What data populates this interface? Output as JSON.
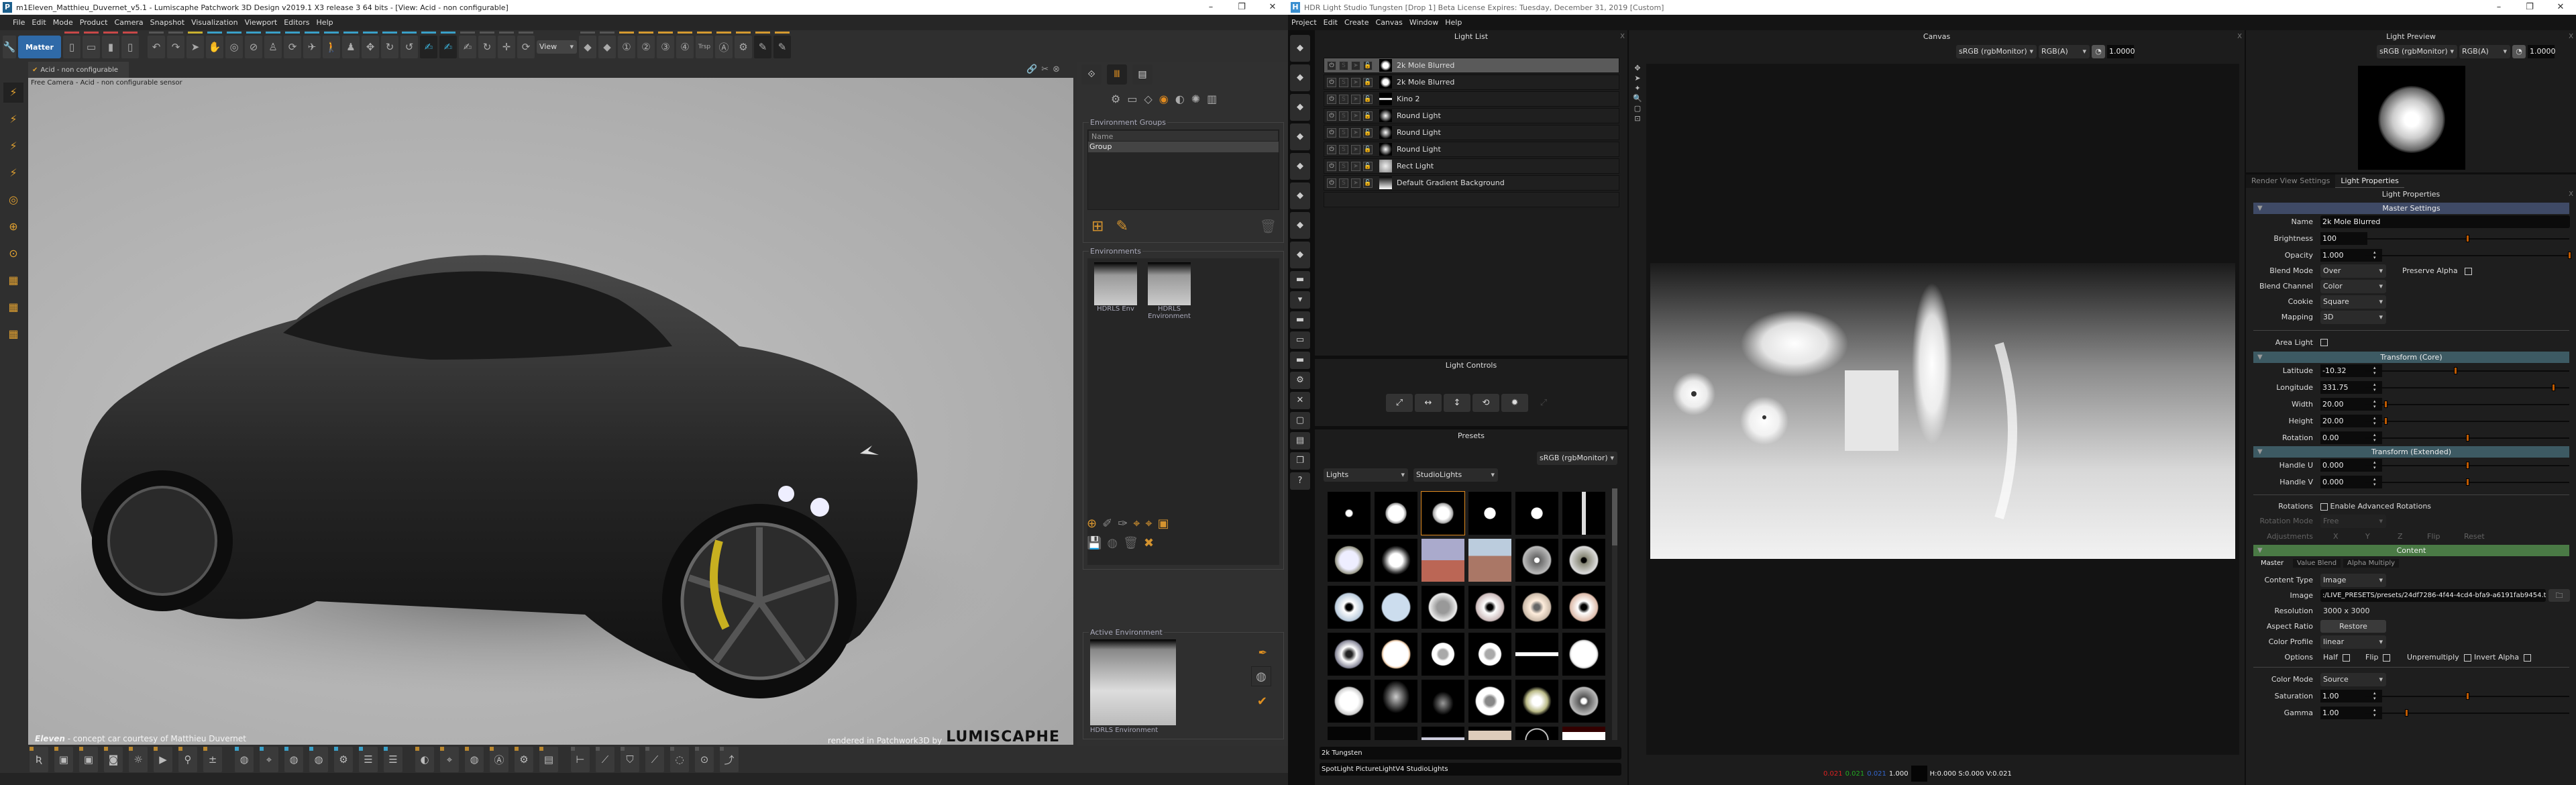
{
  "patchwork": {
    "title": "m1Eleven_Matthieu_Duvernet_v5.1 - Lumiscaphe Patchwork 3D Design v2019.1 X3 release 3  64 bits - [View: Acid - non configurable]",
    "menu": [
      "File",
      "Edit",
      "Mode",
      "Product",
      "Camera",
      "Snapshot",
      "Visualization",
      "Viewport",
      "Editors",
      "Help"
    ],
    "matter_label": "Matter",
    "view_label": "View",
    "trsp_label": "Trsp",
    "toolbar_icons": [
      "new-file",
      "open-file",
      "save",
      "save-as",
      "undo",
      "redo",
      "select",
      "hand",
      "orbit",
      "zoom",
      "light-bulb",
      "rotate-view",
      "fly",
      "walk",
      "person",
      "move-axis",
      "rotate-object",
      "rotate-arbitrary",
      "paint-cyan",
      "paint-cyan-2",
      "paint-gray",
      "paint-refresh",
      "pan-cross",
      "refresh"
    ],
    "toolbar_icons_right": [
      "camera-prev",
      "camera-next",
      "camera-1",
      "camera-2",
      "camera-3",
      "camera-4",
      "transparency",
      "snapshot-a",
      "settings-gear",
      "pencil-active",
      "pencil-disabled"
    ],
    "viewport_tab": "Acid - non configurable",
    "viewport_caption": "Free Camera - Acid - non configurable sensor",
    "credit_prefix": "Eleven",
    "credit_text": " - concept car courtesy of Matthieu Duvernet",
    "rendered_text": "rendered in Patchwork3D by",
    "brand_logo": "LUMISCAPHE",
    "watermark": "LUMISCAPHE",
    "env_groups_title": "Environment Groups",
    "env_groups_col": "Name",
    "env_groups_rows": [
      "Group"
    ],
    "environments_title": "Environments",
    "environments": [
      "HDRLS Env",
      "HDRLS Environment"
    ],
    "active_env_title": "Active Environment",
    "active_env_name": "HDRLS Environment",
    "left_tools": [
      "light-tool",
      "lightning",
      "lightning-2",
      "lightning-3",
      "target",
      "crosshair",
      "eye",
      "chart",
      "chart-2",
      "chart-3"
    ],
    "bottom_tools": [
      "render-r",
      "camera-settings",
      "camera-gear",
      "snapshot",
      "sun",
      "clapper",
      "joystick",
      "list-plus",
      "wheel",
      "location-pin",
      "globe-pin",
      "pin-disc",
      "pin-gear",
      "list-steps",
      "list-lines",
      "disc",
      "dropper-location",
      "globe",
      "globe-a",
      "gear-disc",
      "film",
      "measure",
      "knife",
      "bucket",
      "knife-2",
      "drop-tool",
      "target-arrow",
      "graph"
    ]
  },
  "hdrls": {
    "title": "HDR Light Studio Tungsten [Drop 1] Beta License Expires: Tuesday, December 31, 2019 [Custom]",
    "menu": [
      "Project",
      "Edit",
      "Create",
      "Canvas",
      "Window",
      "Help"
    ],
    "light_list": {
      "title": "Light List",
      "items": [
        {
          "name": "2k Mole Blurred",
          "selected": true
        },
        {
          "name": "2k Mole Blurred"
        },
        {
          "name": "Kino 2"
        },
        {
          "name": "Round Light"
        },
        {
          "name": "Round Light"
        },
        {
          "name": "Round Light"
        },
        {
          "name": "Rect Light"
        },
        {
          "name": "Default Gradient Background"
        }
      ]
    },
    "light_controls": {
      "title": "Light Controls",
      "icons": [
        "scale-diagonal",
        "scale-horizontal",
        "scale-vertical",
        "rotate-light",
        "brightness-sun",
        "move-disabled"
      ]
    },
    "presets": {
      "title": "Presets",
      "colorspace": "sRGB (rgbMonitor)",
      "category": "Lights",
      "subcategory": "StudioLights",
      "selected_index": 2,
      "selected_name": "2k Tungsten",
      "tags": "SpotLight PictureLightV4 StudioLights"
    },
    "canvas": {
      "title": "Canvas",
      "colorspace": "sRGB (rgbMonitor)",
      "channels": "RGB(A)",
      "exposure": "1.0000",
      "pixel_r": "0.021",
      "pixel_g": "0.021",
      "pixel_b": "0.021",
      "pixel_a": "1.000",
      "hsv": "H:0.000 S:0.000 V:0.021"
    },
    "light_preview": {
      "title": "Light Preview",
      "colorspace": "sRGB (rgbMonitor)",
      "channels": "RGB(A)",
      "exposure": "1.0000"
    },
    "tabs": [
      "Render View Settings",
      "Light Properties"
    ],
    "props": {
      "title": "Light Properties",
      "master": "Master Settings",
      "name_label": "Name",
      "name": "2k Mole Blurred",
      "brightness_label": "Brightness",
      "brightness": "100",
      "brightness_level": 0.5,
      "opacity_label": "Opacity",
      "opacity": "1.000",
      "opacity_level": 1.0,
      "blend_mode_label": "Blend Mode",
      "blend_mode": "Over",
      "preserve_alpha": "Preserve Alpha",
      "blend_channel_label": "Blend Channel",
      "blend_channel": "Color",
      "cookie_label": "Cookie",
      "cookie": "Square",
      "mapping_label": "Mapping",
      "mapping": "3D",
      "area_light": "Area Light",
      "transform_core": "Transform (Core)",
      "latitude_label": "Latitude",
      "latitude": "-10.32",
      "latitude_level": 0.44,
      "longitude_label": "Longitude",
      "longitude": "331.75",
      "longitude_level": 0.92,
      "width_label": "Width",
      "width": "20.00",
      "width_level": 0.1,
      "height_label": "Height",
      "height": "20.00",
      "height_level": 0.1,
      "rotation_label": "Rotation",
      "rotation": "0.00",
      "rotation_level": 0.5,
      "transform_ext": "Transform (Extended)",
      "handle_u_label": "Handle U",
      "handle_u": "0.000",
      "handle_u_level": 0.5,
      "handle_v_label": "Handle V",
      "handle_v": "0.000",
      "handle_v_level": 0.5,
      "rotations_label": "Rotations",
      "adv_rot": "Enable Advanced Rotations",
      "rot_mode_label": "Rotation Mode",
      "rot_mode": "Free",
      "adjustments_label": "Adjustments",
      "adj_x": "X",
      "adj_y": "Y",
      "adj_z": "Z",
      "flip": "Flip",
      "reset": "Reset",
      "content": "Content",
      "content_tabs": [
        "Master",
        "Value Blend",
        "Alpha Multiply"
      ],
      "content_type_label": "Content Type",
      "content_type": "Image",
      "image_label": "Image",
      "image": ":/LIVE_PRESETS/presets/24df7286-4f44-4cd4-bfa9-a6191fab9454.tx",
      "resolution_label": "Resolution",
      "resolution": "3000 x 3000",
      "aspect_label": "Aspect Ratio",
      "restore": "Restore",
      "color_profile_label": "Color Profile",
      "color_profile": "linear",
      "options_label": "Options",
      "opt_half": "Half",
      "opt_flip": "Flip",
      "opt_unpremultiply": "Unpremultiply",
      "opt_invert_alpha": "Invert Alpha",
      "color_mode_label": "Color Mode",
      "color_mode": "Source",
      "saturation_label": "Saturation",
      "saturation": "1.00",
      "saturation_level": 0.5,
      "gamma_label": "Gamma",
      "gamma": "1.00",
      "gamma_level": 0.2
    },
    "left_tools": [
      "add-light-1",
      "add-light-2",
      "add-light-3",
      "add-light-4",
      "add-light-5",
      "add-light-6",
      "add-light-7",
      "add-light-8",
      "grid-1",
      "grid-2",
      "grid-3",
      "grid-4",
      "grid-5",
      "gear",
      "close",
      "square",
      "film",
      "layers",
      "help"
    ]
  },
  "colors": {
    "accent_orange": "#c05a00",
    "preset_selected": "#e08a1e",
    "master_header": "#3f4a66",
    "transform_header": "#3d5a63",
    "content_header": "#4a7a45",
    "matter_blue": "#2f6aa8"
  }
}
